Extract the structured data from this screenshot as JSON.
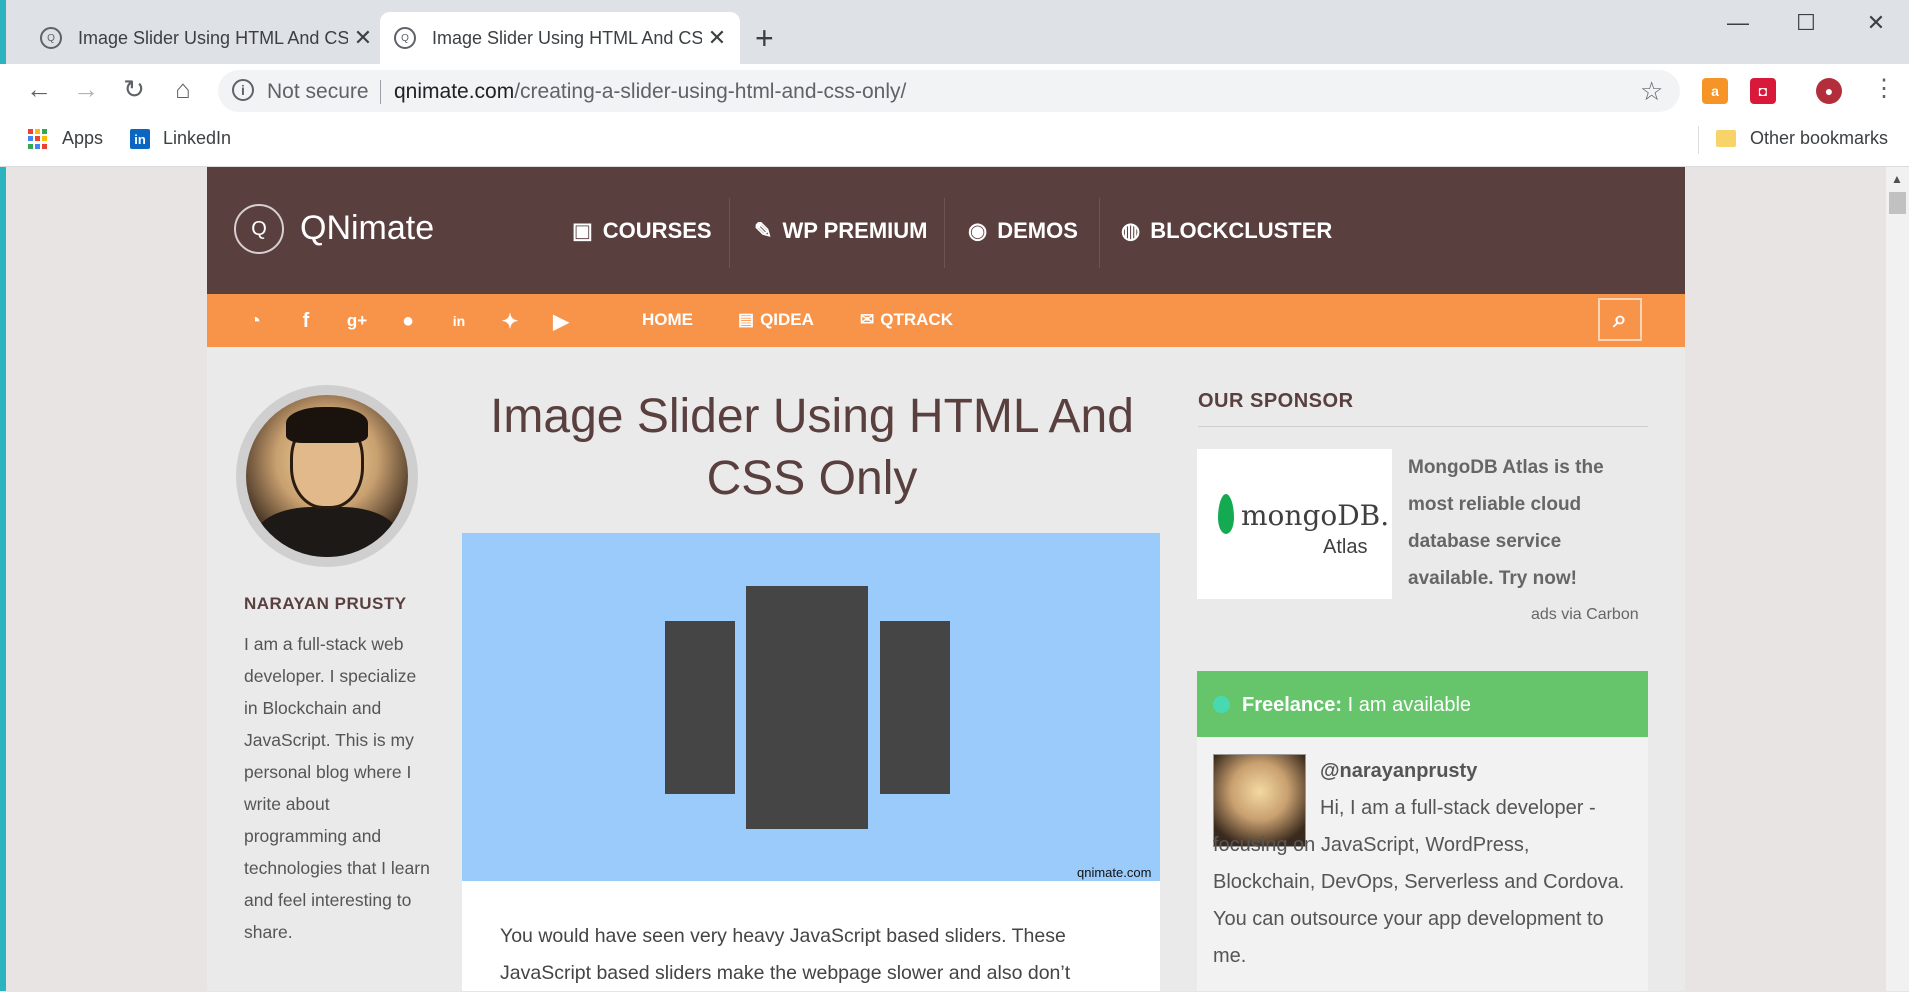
{
  "browser": {
    "tabs": [
      {
        "title": "Image Slider Using HTML And CSS Only",
        "active": false
      },
      {
        "title": "Image Slider Using HTML And CSS Only",
        "active": true
      }
    ],
    "new_tab_icon": "plus-icon",
    "window_controls": {
      "minimize": "—",
      "maximize": "☐",
      "close": "✕"
    },
    "nav": {
      "back": "←",
      "forward": "→",
      "reload": "↻",
      "home": "⌂"
    },
    "omnibox": {
      "security_label": "Not secure",
      "url_host": "qnimate.com",
      "url_path": "/creating-a-slider-using-html-and-css-only/"
    },
    "extensions": [
      {
        "name": "amazon-assistant-icon",
        "glyph": "a",
        "color": "#f79428"
      },
      {
        "name": "pocket-extension-icon",
        "glyph": "◘",
        "color": "#d8193a"
      },
      {
        "name": "profile-extension-icon",
        "glyph": "●",
        "color": "#b22e3a"
      }
    ],
    "bookmarks": {
      "apps_label": "Apps",
      "items": [
        {
          "label": "LinkedIn",
          "icon": "linkedin-icon"
        }
      ],
      "other_label": "Other bookmarks"
    }
  },
  "site": {
    "name": "QNimate",
    "main_nav": [
      {
        "label": "COURSES",
        "icon": "film-icon"
      },
      {
        "label": "WP PREMIUM",
        "icon": "plug-icon"
      },
      {
        "label": "DEMOS",
        "icon": "eye-icon"
      },
      {
        "label": "BLOCKCLUSTER",
        "icon": "globe-icon"
      }
    ],
    "social_icons": [
      "rss-icon",
      "facebook-icon",
      "google-plus-icon",
      "github-icon",
      "linkedin-icon",
      "twitter-icon",
      "youtube-icon"
    ],
    "sub_nav": [
      {
        "label": "HOME",
        "icon": ""
      },
      {
        "label": "QIDEA",
        "icon": "newspaper-icon"
      },
      {
        "label": "QTRACK",
        "icon": "mail-icon"
      }
    ],
    "colors": {
      "header": "#5a3f3f",
      "accent": "#f7944a",
      "freelance": "#66c46b"
    }
  },
  "author": {
    "name": "NARAYAN PRUSTY",
    "bio": "I am a full-stack web developer. I specialize in Blockchain and JavaScript. This is my personal blog where I write about programming and technologies that I learn and feel interesting to share."
  },
  "post": {
    "title": "Image Slider Using HTML And CSS Only",
    "image_credit": "qnimate.com",
    "intro": "You would have seen very heavy JavaScript based sliders. These JavaScript based sliders make the webpage slower and also don’t"
  },
  "sidebar": {
    "sponsor_heading": "OUR SPONSOR",
    "ad": {
      "brand": "mongoDB.",
      "product": "Atlas",
      "text": "MongoDB Atlas is the most reliable cloud database service available. Try now!",
      "via": "ads via Carbon"
    },
    "freelance": {
      "label": "Freelance:",
      "status": "I am available",
      "handle": "@narayanprusty",
      "bio": "Hi, I am a full-stack developer - focusing on JavaScript, WordPress, Blockchain, DevOps, Serverless and Cordova. You can outsource your app development to me."
    }
  }
}
